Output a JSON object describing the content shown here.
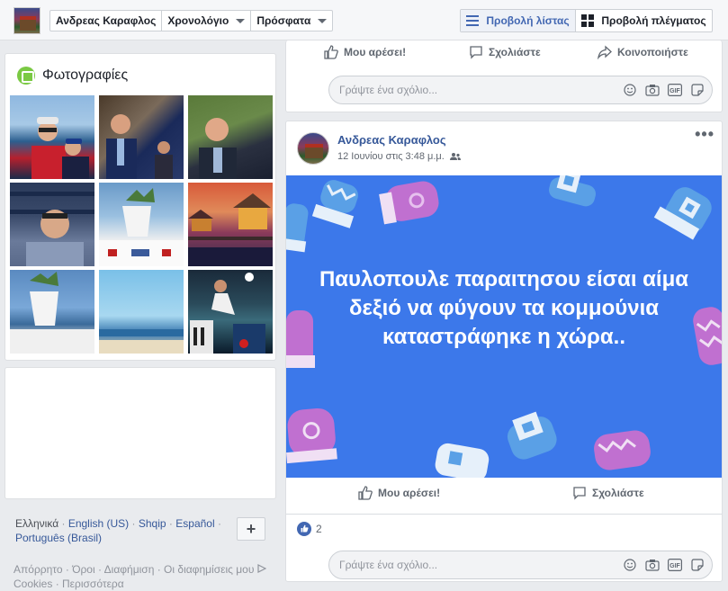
{
  "topbar": {
    "profile_name": "Ανδρεας Καραφλος",
    "timeline_label": "Χρονολόγιο",
    "recent_label": "Πρόσφατα",
    "list_view_label": "Προβολή λίστας",
    "grid_view_label": "Προβολή πλέγματος"
  },
  "photos": {
    "title": "Φωτογραφίες",
    "count": 9
  },
  "languages": {
    "items": [
      "Ελληνικά",
      "English (US)",
      "Shqip",
      "Español",
      "Português (Brasil)"
    ],
    "separator": "·",
    "add_label": "+"
  },
  "footer": {
    "line1": "Απόρρητο · Όροι · Διαφήμιση · Οι διαφημίσεις μου",
    "line2": "Cookies · Περισσότερα"
  },
  "post1": {
    "like_label": "Μου αρέσει!",
    "comment_label": "Σχολιάστε",
    "share_label": "Κοινοποιήστε",
    "comment_placeholder": "Γράψτε ένα σχόλιο..."
  },
  "post2": {
    "author": "Ανδρεας Καραφλος",
    "date": "12 Ιουνίου στις 3:48 μ.μ.",
    "text": "Παυλοπουλε παραιτησου είσαι αίμα δεξιό να φύγουν τα κομμούνια καταστράφηκε η χώρα..",
    "like_label": "Μου αρέσει!",
    "comment_label": "Σχολιάστε",
    "reactions_count": "2",
    "comment_placeholder": "Γράψτε ένα σχόλιο...",
    "background_color": "#3c78ea"
  },
  "comment_icons": [
    "emoji-icon",
    "camera-icon",
    "gif-icon",
    "sticker-icon"
  ],
  "gif_label": "GIF",
  "colors": {
    "link": "#365899",
    "accent": "#4267b2"
  }
}
